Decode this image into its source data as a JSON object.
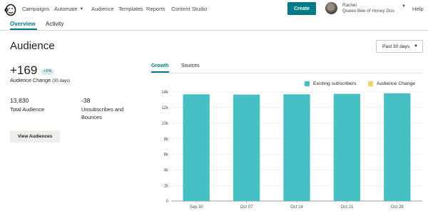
{
  "nav": {
    "items": [
      "Campaigns",
      "Automate",
      "Audience",
      "Templates",
      "Reports",
      "Content Studio"
    ],
    "create_label": "Create",
    "user_name": "Rachel",
    "user_org": "Queen Bee of Honey Dos",
    "help_label": "Help"
  },
  "subtabs": [
    "Overview",
    "Activity"
  ],
  "page_title": "Audience",
  "date_range": "Past 30 days",
  "stats": {
    "change_value": "+169",
    "change_badge": "+1%",
    "change_label": "Audience Change",
    "change_period": "(30 days)",
    "total_value": "13,830",
    "total_label": "Total Audience",
    "unsub_value": "-38",
    "unsub_label_1": "Unsubscribes and",
    "unsub_label_2": "Bounces",
    "view_button": "View Audiences"
  },
  "chart_tabs": [
    "Growth",
    "Sources"
  ],
  "colors": {
    "accent": "#007c89",
    "bar": "#46c0c5",
    "legend_change": "#f5cf6b"
  },
  "chart_data": {
    "type": "bar",
    "categories": [
      "Sep 30",
      "Oct 07",
      "Oct 14",
      "Oct 21",
      "Oct 28"
    ],
    "series": [
      {
        "name": "Existing subscribers",
        "values": [
          13700,
          13660,
          13700,
          13760,
          13830
        ]
      },
      {
        "name": "Audience Change",
        "values": [
          0,
          0,
          0,
          0,
          0
        ]
      }
    ],
    "y_ticks": [
      "0",
      "2k",
      "4k",
      "6k",
      "8k",
      "10k",
      "12k",
      "14k"
    ],
    "ylim": [
      0,
      14000
    ],
    "grid": true,
    "legend_position": "top-right"
  }
}
